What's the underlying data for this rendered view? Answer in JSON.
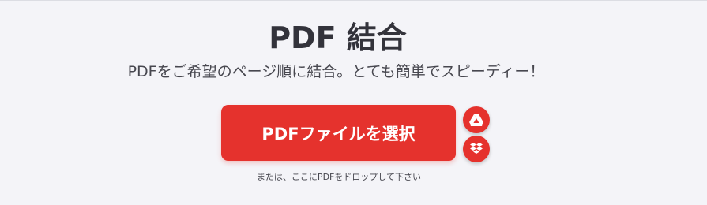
{
  "header": {
    "title": "PDF 結合",
    "subtitle": "PDFをご希望のページ順に結合。とても簡単でスピーディー！"
  },
  "upload": {
    "select_button_label": "PDFファイルを選択",
    "drop_hint": "または、ここにPDFをドロップして下さい",
    "cloud_sources": [
      {
        "icon": "google-drive-icon"
      },
      {
        "icon": "dropbox-icon"
      }
    ]
  },
  "colors": {
    "accent": "#e5322d",
    "background": "#f4f4f8",
    "title_text": "#33333b"
  }
}
